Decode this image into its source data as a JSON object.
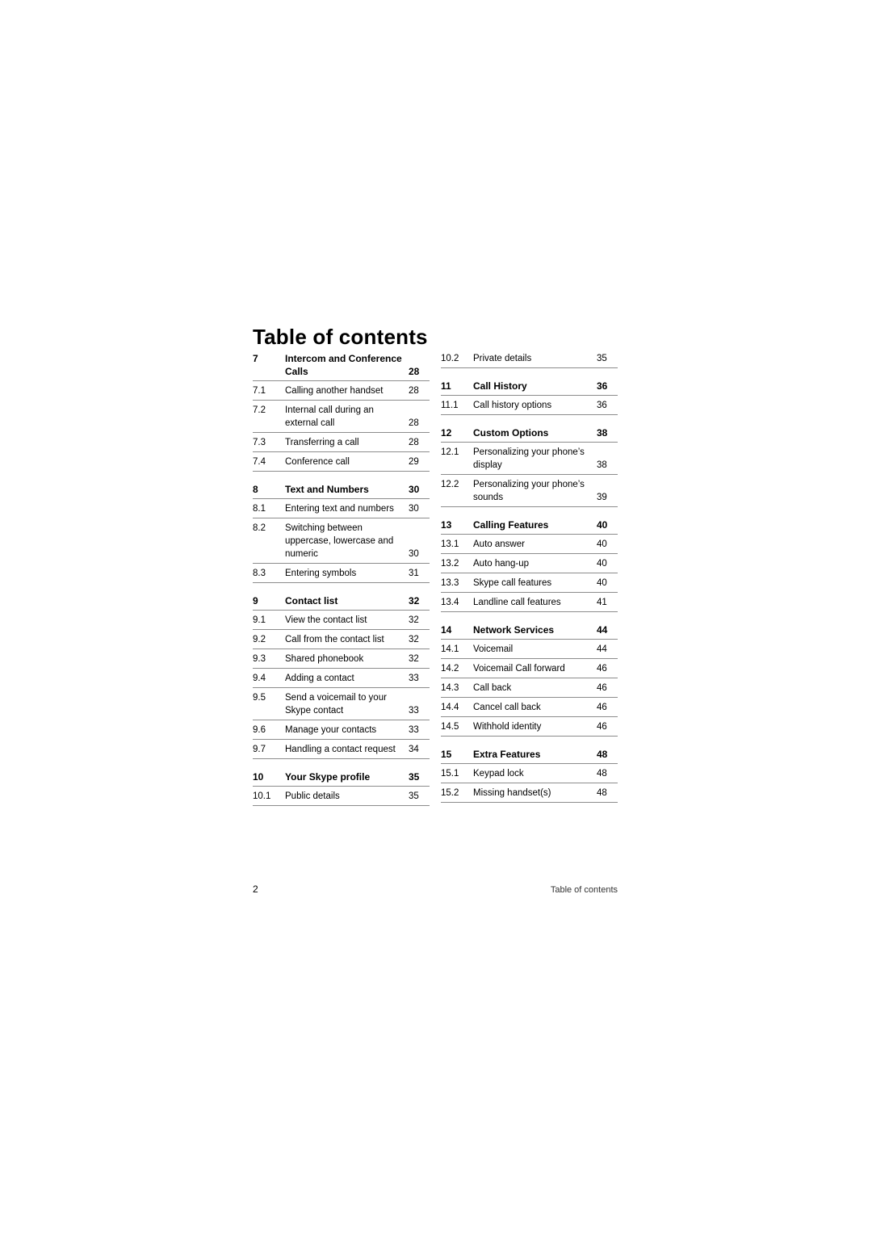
{
  "document": {
    "title": "Table of contents",
    "footer_page_number": "2",
    "footer_text": "Table of contents"
  },
  "left_column": [
    {
      "num": "7",
      "label": "Intercom and Conference Calls",
      "page": "28",
      "type": "section",
      "two_line": true
    },
    {
      "num": "7.1",
      "label": "Calling another handset",
      "page": "28",
      "type": "entry"
    },
    {
      "num": "7.2",
      "label": "Internal call during an external call",
      "page": "28",
      "type": "entry",
      "two_line": true
    },
    {
      "num": "7.3",
      "label": "Transferring a call",
      "page": "28",
      "type": "entry"
    },
    {
      "num": "7.4",
      "label": "Conference call",
      "page": "29",
      "type": "entry"
    },
    {
      "num": "8",
      "label": "Text and Numbers",
      "page": "30",
      "type": "section",
      "spacer_before": true
    },
    {
      "num": "8.1",
      "label": "Entering text and numbers",
      "page": "30",
      "type": "entry"
    },
    {
      "num": "8.2",
      "label": "Switching between uppercase, lowercase and numeric",
      "page": "30",
      "type": "entry",
      "two_line": true
    },
    {
      "num": "8.3",
      "label": "Entering symbols",
      "page": "31",
      "type": "entry"
    },
    {
      "num": "9",
      "label": "Contact list",
      "page": "32",
      "type": "section",
      "spacer_before": true
    },
    {
      "num": "9.1",
      "label": "View the contact list",
      "page": "32",
      "type": "entry"
    },
    {
      "num": "9.2",
      "label": "Call from the contact list",
      "page": "32",
      "type": "entry"
    },
    {
      "num": "9.3",
      "label": "Shared phonebook",
      "page": "32",
      "type": "entry"
    },
    {
      "num": "9.4",
      "label": "Adding a contact",
      "page": "33",
      "type": "entry"
    },
    {
      "num": "9.5",
      "label": "Send a voicemail to your Skype contact",
      "page": "33",
      "type": "entry",
      "two_line": true
    },
    {
      "num": "9.6",
      "label": "Manage your contacts",
      "page": "33",
      "type": "entry"
    },
    {
      "num": "9.7",
      "label": "Handling a contact request",
      "page": "34",
      "type": "entry"
    },
    {
      "num": "10",
      "label": "Your Skype profile",
      "page": "35",
      "type": "section",
      "spacer_before": true
    },
    {
      "num": "10.1",
      "label": "Public details",
      "page": "35",
      "type": "entry"
    }
  ],
  "right_column": [
    {
      "num": "10.2",
      "label": "Private details",
      "page": "35",
      "type": "entry"
    },
    {
      "num": "11",
      "label": "Call History",
      "page": "36",
      "type": "section",
      "spacer_before": true
    },
    {
      "num": "11.1",
      "label": "Call history options",
      "page": "36",
      "type": "entry"
    },
    {
      "num": "12",
      "label": "Custom Options",
      "page": "38",
      "type": "section",
      "spacer_before": true
    },
    {
      "num": "12.1",
      "label": "Personalizing your phone’s display",
      "page": "38",
      "type": "entry",
      "two_line": true
    },
    {
      "num": "12.2",
      "label": "Personalizing your phone’s sounds",
      "page": "39",
      "type": "entry",
      "two_line": true
    },
    {
      "num": "13",
      "label": "Calling Features",
      "page": "40",
      "type": "section",
      "spacer_before": true
    },
    {
      "num": "13.1",
      "label": "Auto answer",
      "page": "40",
      "type": "entry"
    },
    {
      "num": "13.2",
      "label": "Auto hang-up",
      "page": "40",
      "type": "entry"
    },
    {
      "num": "13.3",
      "label": "Skype call features",
      "page": "40",
      "type": "entry"
    },
    {
      "num": "13.4",
      "label": "Landline call features",
      "page": "41",
      "type": "entry"
    },
    {
      "num": "14",
      "label": "Network Services",
      "page": "44",
      "type": "section",
      "spacer_before": true
    },
    {
      "num": "14.1",
      "label": "Voicemail",
      "page": "44",
      "type": "entry"
    },
    {
      "num": "14.2",
      "label": "Voicemail Call forward",
      "page": "46",
      "type": "entry"
    },
    {
      "num": "14.3",
      "label": "Call back",
      "page": "46",
      "type": "entry"
    },
    {
      "num": "14.4",
      "label": "Cancel call back",
      "page": "46",
      "type": "entry"
    },
    {
      "num": "14.5",
      "label": "Withhold identity",
      "page": "46",
      "type": "entry"
    },
    {
      "num": "15",
      "label": "Extra Features",
      "page": "48",
      "type": "section",
      "spacer_before": true
    },
    {
      "num": "15.1",
      "label": "Keypad lock",
      "page": "48",
      "type": "entry"
    },
    {
      "num": "15.2",
      "label": "Missing handset(s)",
      "page": "48",
      "type": "entry"
    }
  ]
}
